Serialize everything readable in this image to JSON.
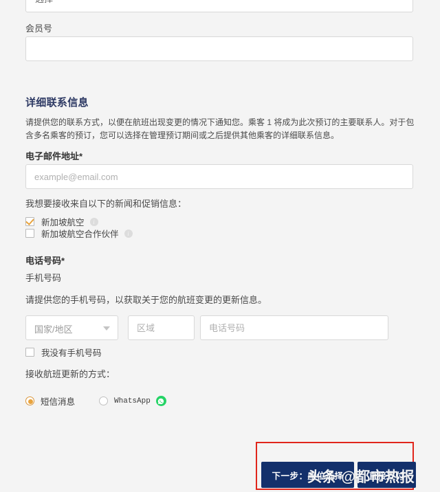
{
  "top_partial_field": {
    "value": "选择"
  },
  "membership": {
    "label": "会员号",
    "value": ""
  },
  "contact_section": {
    "title": "详细联系信息",
    "description": "请提供您的联系方式，以便在航班出现变更的情况下通知您。乘客 1 将成为此次预订的主要联系人。对于包含多名乘客的预订，您可以选择在管理预订期间或之后提供其他乘客的详细联系信息。"
  },
  "email": {
    "label": "电子邮件地址*",
    "placeholder": "example@email.com",
    "value": ""
  },
  "marketing": {
    "prompt": "我想要接收来自以下的新闻和促销信息：",
    "options": [
      {
        "label": "新加坡航空",
        "checked": true,
        "info": "i"
      },
      {
        "label": "新加坡航空合作伙伴",
        "checked": false,
        "info": "i"
      }
    ]
  },
  "phone": {
    "label": "电话号码*",
    "sublabel": "手机号码",
    "description": "请提供您的手机号码，以获取关于您的航班变更的更新信息。",
    "country_placeholder": "国家/地区",
    "area_placeholder": "区域",
    "number_placeholder": "电话号码",
    "no_mobile_label": "我没有手机号码",
    "no_mobile_checked": false
  },
  "updates": {
    "prompt": "接收航班更新的方式：",
    "options": [
      {
        "label": "短信消息",
        "selected": true
      },
      {
        "label": "WhatsApp",
        "selected": false,
        "icon": "whatsapp-icon"
      }
    ]
  },
  "actions": {
    "primary_label": "下一步：座位选择",
    "secondary_label": "直接支付",
    "highlight_color": "#e0251b",
    "button_color": "#13306b"
  },
  "watermark": {
    "text": "头条 @都市热报"
  }
}
